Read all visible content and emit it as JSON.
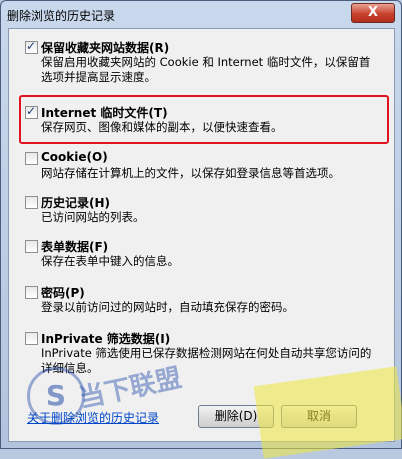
{
  "window": {
    "title": "删除浏览的历史记录",
    "close_symbol": "X"
  },
  "options": [
    {
      "label": "保留收藏夹网站数据(R)",
      "description": "保留启用收藏夹网站的 Cookie 和 Internet 临时文件，以保留首选项并提高显示速度。",
      "checked": true
    },
    {
      "label": "Internet 临时文件(T)",
      "description": "保存网页、图像和媒体的副本，以便快速查看。",
      "checked": true
    },
    {
      "label": "Cookie(O)",
      "description": "网站存储在计算机上的文件，以保存如登录信息等首选项。",
      "checked": false
    },
    {
      "label": "历史记录(H)",
      "description": "已访问网站的列表。",
      "checked": false
    },
    {
      "label": "表单数据(F)",
      "description": "保存在表单中键入的信息。",
      "checked": false
    },
    {
      "label": "密码(P)",
      "description": "登录以前访问过的网站时，自动填充保存的密码。",
      "checked": false
    },
    {
      "label": "InPrivate 筛选数据(I)",
      "description": "InPrivate 筛选使用已保存数据检测网站在何处自动共享您访问的详细信息。",
      "checked": false
    }
  ],
  "footer": {
    "help_link": "关于删除浏览的历史记录",
    "delete_button": "删除(D)",
    "cancel_button": "取消"
  },
  "watermark": {
    "logo_letter": "S",
    "text": "当下联盟"
  }
}
